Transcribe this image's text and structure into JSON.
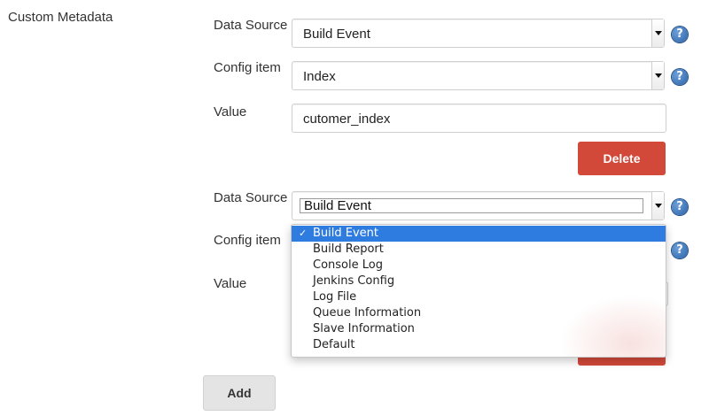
{
  "section": {
    "label": "Custom Metadata"
  },
  "entry1": {
    "data_source_label": "Data Source",
    "data_source_value": "Build Event",
    "config_item_label": "Config item",
    "config_item_value": "Index",
    "value_label": "Value",
    "value_value": "cutomer_index",
    "delete_label": "Delete"
  },
  "entry2": {
    "data_source_label": "Data Source",
    "data_source_value": "Build Event",
    "config_item_label": "Config item",
    "value_label": "Value"
  },
  "dropdown": {
    "options": [
      "Build Event",
      "Build Report",
      "Console Log",
      "Jenkins Config",
      "Log File",
      "Queue Information",
      "Slave Information",
      "Default"
    ],
    "selected_index": 0,
    "check_glyph": "✓"
  },
  "add_label": "Add",
  "help_glyph": "?",
  "icons": {
    "help": "help-question-icon",
    "arrow": "chevron-down-icon",
    "check": "checkmark-icon"
  },
  "colors": {
    "delete": "#d24939",
    "help": "#2b63a8",
    "selected": "#2f7ce0",
    "add": "#e4e4e4"
  }
}
